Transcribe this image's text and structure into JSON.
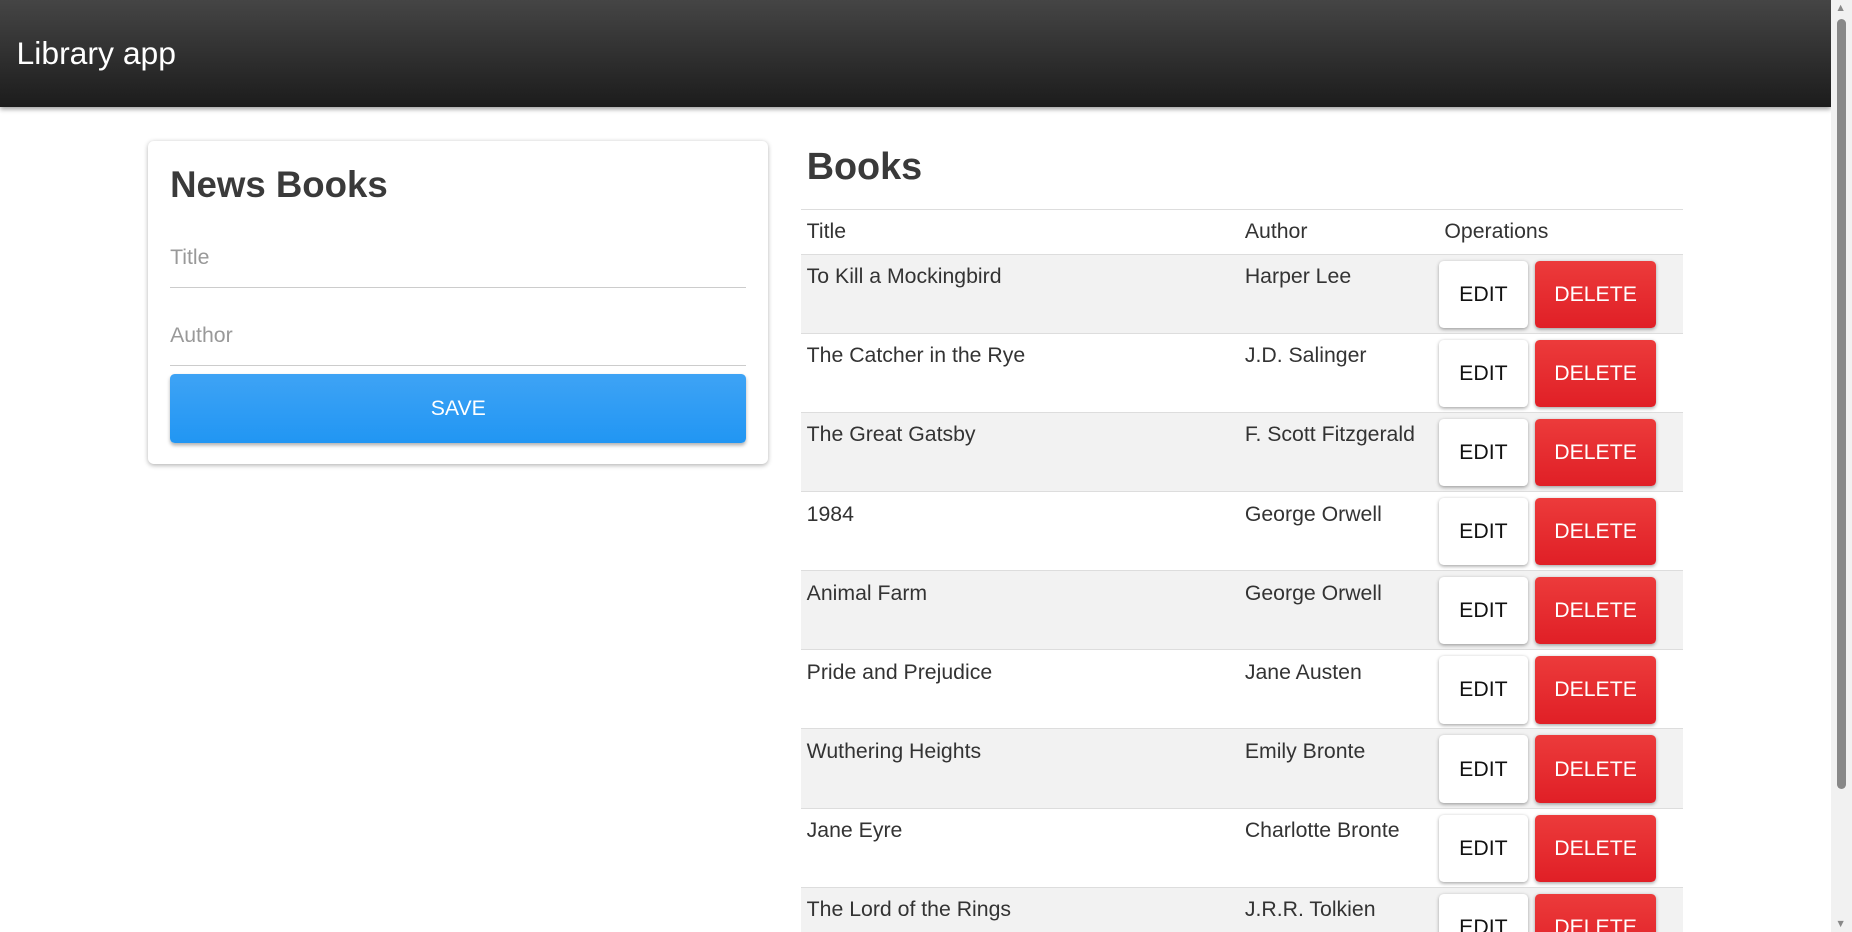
{
  "header": {
    "title": "Library app"
  },
  "form": {
    "heading": "News Books",
    "title_placeholder": "Title",
    "author_placeholder": "Author",
    "save_label": "SAVE"
  },
  "books": {
    "heading": "Books",
    "columns": [
      "Title",
      "Author",
      "Operations"
    ],
    "edit_label": "EDIT",
    "delete_label": "DELETE",
    "rows": [
      {
        "title": "To Kill a Mockingbird",
        "author": "Harper Lee"
      },
      {
        "title": "The Catcher in the Rye",
        "author": "J.D. Salinger"
      },
      {
        "title": "The Great Gatsby",
        "author": "F. Scott Fitzgerald"
      },
      {
        "title": "1984",
        "author": "George Orwell"
      },
      {
        "title": "Animal Farm",
        "author": "George Orwell"
      },
      {
        "title": "Pride and Prejudice",
        "author": "Jane Austen"
      },
      {
        "title": "Wuthering Heights",
        "author": "Emily Bronte"
      },
      {
        "title": "Jane Eyre",
        "author": "Charlotte Bronte"
      },
      {
        "title": "The Lord of the Rings",
        "author": "J.R.R. Tolkien"
      }
    ]
  },
  "colors": {
    "primary": "#2196f3",
    "danger": "#e01f26",
    "header": "#2a2a2a"
  }
}
